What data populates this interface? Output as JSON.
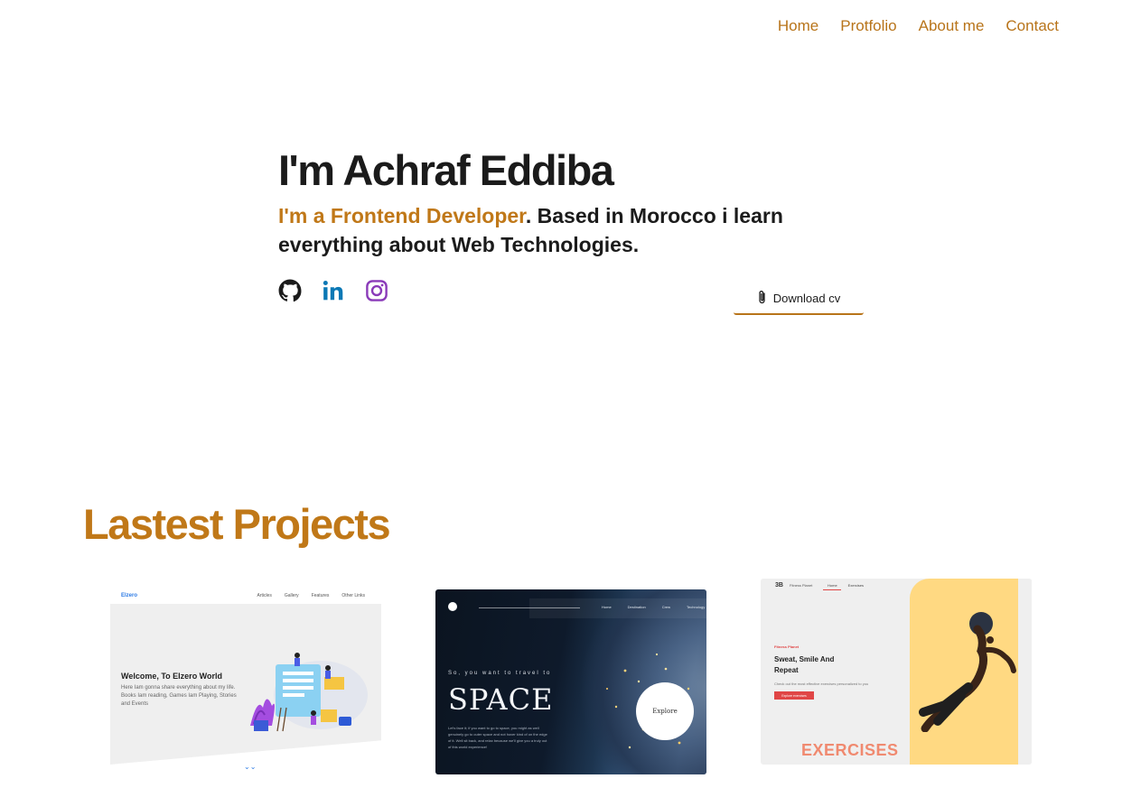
{
  "nav": {
    "items": [
      "Home",
      "Protfolio",
      "About me",
      "Contact"
    ]
  },
  "hero": {
    "title": "I'm Achraf Eddiba",
    "tagline_accent": "I'm a Frontend Developer",
    "tagline_rest": ". Based in Morocco i learn everything about Web Technologies.",
    "cv_label": "Download cv"
  },
  "socials": [
    "github-icon",
    "linkedin-icon",
    "instagram-icon"
  ],
  "projects": {
    "title": "Lastest Projects",
    "card1": {
      "logo": "Elzero",
      "links": [
        "Articles",
        "Gallery",
        "Features",
        "Other Links"
      ],
      "heading": "Welcome, To Elzero World",
      "text": "Here Iam gonna share everything about my life. Books Iam reading, Games Iam Playing, Stories and Events"
    },
    "card2": {
      "links": [
        "Home",
        "Destination",
        "Crew",
        "Technology"
      ],
      "sub": "So, you want to travel to",
      "title": "SPACE",
      "text": "Let's face it; if you want to go to space, you might as well genuinely go to outer space and not hover kind of on the edge of it. Well sit back, and relax because we'll give you a truly out of this world experience!",
      "button": "Explore"
    },
    "card3": {
      "logo": "3B",
      "brand": "Fitness Planet",
      "links": [
        "Home",
        "Exercises"
      ],
      "tag": "Fitness Planet",
      "heading": "Sweat, Smile And Repeat",
      "text": "Check out the most effective exercises personalized to you",
      "button": "Explore exercises",
      "footer": "EXERCISES"
    }
  },
  "colors": {
    "accent": "#c07818",
    "text": "#1b1b1b"
  }
}
